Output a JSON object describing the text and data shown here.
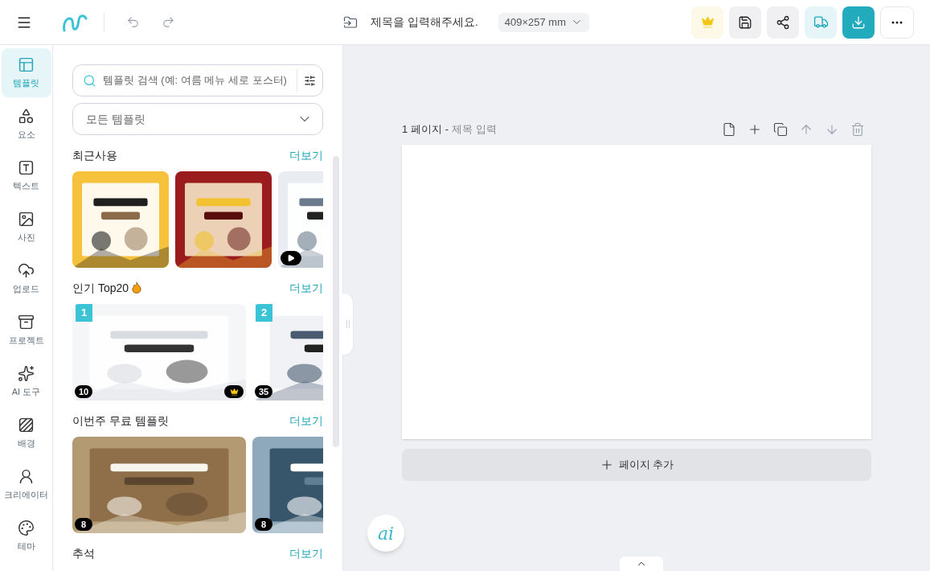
{
  "header": {
    "title": "제목을 입력해주세요.",
    "size": "409×257 mm"
  },
  "sidebar": {
    "items": [
      {
        "label": "템플릿",
        "kind": "template",
        "selected": true
      },
      {
        "label": "요소",
        "kind": "elements",
        "selected": false
      },
      {
        "label": "텍스트",
        "kind": "text",
        "selected": false
      },
      {
        "label": "사진",
        "selected": false
      },
      {
        "label": "업로드",
        "kind": "upload",
        "selected": false
      },
      {
        "label": "프로젝트",
        "kind": "project",
        "selected": false
      },
      {
        "label": "AI 도구",
        "kind": "ai",
        "selected": false
      },
      {
        "label": "배경",
        "kind": "background",
        "selected": false
      },
      {
        "label": "크리에이터",
        "kind": "creator",
        "selected": false
      },
      {
        "label": "테마",
        "kind": "theme",
        "selected": false
      }
    ]
  },
  "panel": {
    "search": {
      "placeholder": "템플릿 검색 (예: 여름 메뉴 세로 포스터)"
    },
    "filter": {
      "value": "모든 템플릿"
    },
    "sections": [
      {
        "title": "최근사용",
        "more": "더보기",
        "kind": "square",
        "items": [
          {
            "kind": "picture"
          },
          {
            "kind": "picture"
          },
          {
            "kind": "picture",
            "video": true
          }
        ]
      },
      {
        "title": "인기 Top20",
        "flame": true,
        "more": "더보기",
        "kind": "wide",
        "items": [
          {
            "kind": "picture",
            "rank": "1",
            "pages": "10",
            "premium": true
          },
          {
            "kind": "picture",
            "rank": "2",
            "pages": "35"
          }
        ]
      },
      {
        "title": "이번주 무료 템플릿",
        "more": "더보기",
        "kind": "wide",
        "items": [
          {
            "kind": "picture",
            "pages": "8"
          },
          {
            "kind": "picture",
            "pages": "8"
          }
        ]
      },
      {
        "title": "추석",
        "more": "더보기"
      }
    ]
  },
  "canvas": {
    "page_label": "1 페이지",
    "separator": "-",
    "title_placeholder": "제목 입력",
    "add_page": "페이지 추가",
    "ai_button": "ai"
  }
}
